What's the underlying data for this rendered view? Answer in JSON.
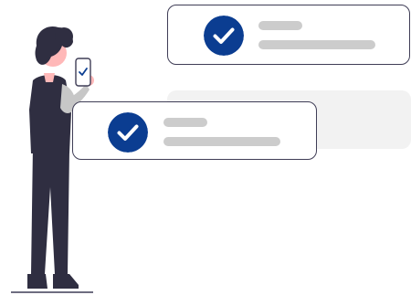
{
  "colors": {
    "accent": "#0b3d91",
    "card_border": "#3f3d56",
    "placeholder_line": "#cccccc",
    "ghost_card": "#f2f2f2",
    "skin": "#ffb8b8",
    "hair": "#2f2e41",
    "sweater": "#c7c7c7",
    "vest": "#2f2e41"
  },
  "illustration": {
    "cards": [
      {
        "status": "checked",
        "icon": "check-circle-icon"
      },
      {
        "status": "placeholder"
      },
      {
        "status": "checked",
        "icon": "check-circle-icon"
      }
    ],
    "figure": {
      "holding": "phone",
      "phone_icon": "check-icon"
    }
  }
}
